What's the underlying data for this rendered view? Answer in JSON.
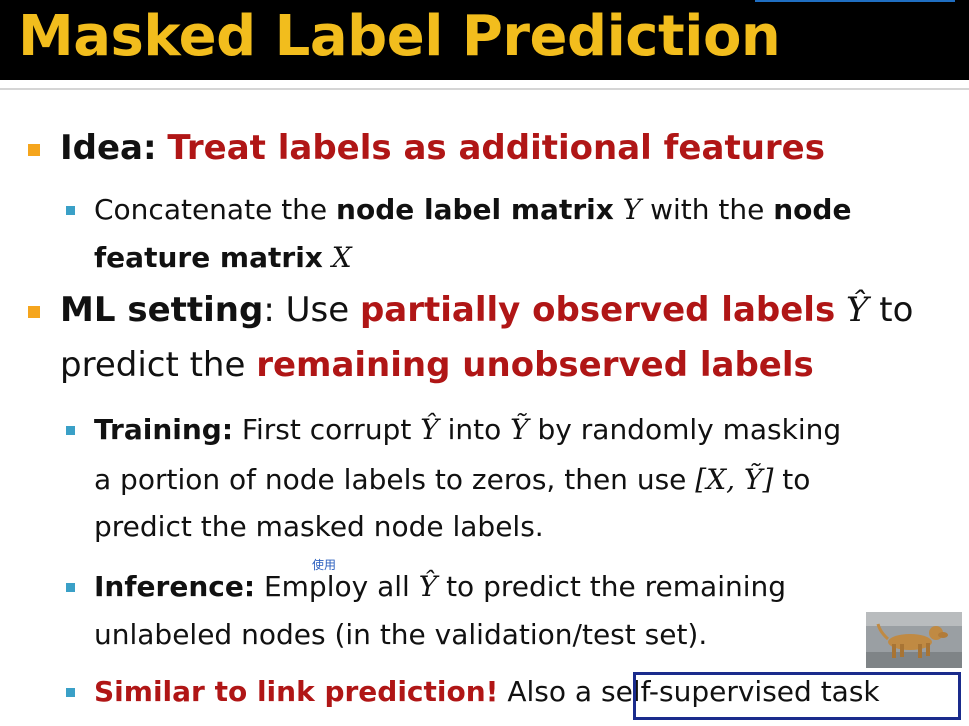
{
  "title": "Masked Label Prediction",
  "bullets": {
    "idea": {
      "label": "Idea:",
      "text": "Treat labels as additional features",
      "sub": {
        "line1_a": "Concatenate the ",
        "line1_b": "node label matrix",
        "line1_c": " Y",
        "line1_d": " with the ",
        "line1_e": "node",
        "line2_a": "feature matrix",
        "line2_b": " X"
      }
    },
    "ml_setting": {
      "label": "ML setting",
      "line1_a": ": Use ",
      "line1_b": "partially observed labels",
      "line1_c": " Ŷ",
      "line1_d": " to",
      "line2_a": "predict the ",
      "line2_b": "remaining unobserved labels"
    },
    "training": {
      "label": "Training:",
      "line1_a": " First corrupt ",
      "line1_b": "Ŷ",
      "line1_c": " into ",
      "line1_d": "Ỹ",
      "line1_e": " by randomly masking",
      "line2_a": "a portion of node labels to zeros, then use ",
      "line2_b": "[X, Ỹ]",
      "line2_c": " to",
      "line3": "predict the masked node labels."
    },
    "inference": {
      "label": "Inference:",
      "line1_a": " Employ all ",
      "line1_b": "Ŷ",
      "line1_c": " to predict the remaining",
      "line2": "unlabeled nodes (in the validation/test set).",
      "annotation": "使用"
    },
    "similar": {
      "label": "Similar to link prediction!",
      "text_a": " Also a ",
      "text_b": "self-supervised  task"
    }
  },
  "colors": {
    "title": "#f2bd1d",
    "emphasis_red": "#b01616",
    "l1_marker": "#f5a51d",
    "l2_marker": "#3aa0c7",
    "highlight_box": "#1a2b8c"
  },
  "image": "dog-photo"
}
